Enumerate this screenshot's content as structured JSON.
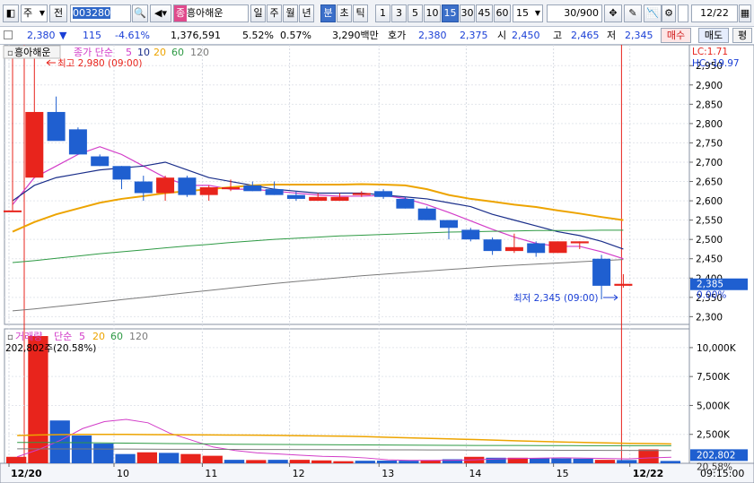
{
  "toolbar": {
    "market": "주",
    "screen_type": "전",
    "stock_code": "003280",
    "stock_badge": "종",
    "stock_name": "흥아해운",
    "periods": [
      "일",
      "주",
      "월",
      "년",
      "분",
      "초",
      "틱"
    ],
    "selected_period": "분",
    "intervals": [
      "1",
      "3",
      "5",
      "10",
      "15",
      "30",
      "45",
      "60"
    ],
    "selected_interval": "15",
    "interval_value": "15",
    "count": "30",
    "count_total": "/900",
    "date_value": "12/22"
  },
  "quote": {
    "price": "2,380",
    "change": "115",
    "change_pct": "-4.61%",
    "volume": "1,376,591",
    "vol_ratio": "5.52%",
    "turnover": "0.57%",
    "amount": "3,290백만",
    "ask_label": "호가",
    "ask": "2,380",
    "bid": "2,375",
    "open_label": "시",
    "open": "2,450",
    "high_label": "고",
    "high": "2,465",
    "low_label": "저",
    "low": "2,345",
    "buy_label": "매수",
    "sell_label": "매도",
    "last_label": "평"
  },
  "colors": {
    "up": "#e8241c",
    "down": "#1f5fd0",
    "ma5": "#d23cc8",
    "ma10": "#1a2e8a",
    "ma20": "#eda400",
    "ma60": "#2e9a44",
    "ma120": "#7a7a7a"
  },
  "price_panel": {
    "name": "흥아해운",
    "legend_prefix": "종가 단순",
    "ma_periods": [
      "5",
      "10",
      "20",
      "60",
      "120"
    ],
    "high_note": "최고 2,980 (09:00)",
    "low_note": "최저 2,345 (09:00)",
    "lc": "LC:1.71",
    "hc": "HC:-19.97",
    "current_price": "2,385",
    "current_pct": "0.00%"
  },
  "volume_panel": {
    "label": "거래량",
    "legend_prefix": "단순",
    "ma_periods": [
      "5",
      "20",
      "60",
      "120"
    ],
    "current_note": "202,802주(20.58%)",
    "current_value": "202,802",
    "current_pct": "20.58%"
  },
  "chart_data": [
    {
      "type": "candlestick",
      "title": "흥아해운",
      "x_labels": [
        "12/20",
        "10",
        "11",
        "12",
        "13",
        "14",
        "15",
        "12/22"
      ],
      "y_ticks": [
        2300,
        2350,
        2400,
        2450,
        2500,
        2550,
        2600,
        2650,
        2700,
        2750,
        2800,
        2850,
        2900,
        2950
      ],
      "ylim": [
        2280,
        2990
      ],
      "candles": [
        {
          "o": 2575,
          "h": 2975,
          "l": 2575,
          "c": 2575
        },
        {
          "o": 2660,
          "h": 2980,
          "l": 2660,
          "c": 2830
        },
        {
          "o": 2830,
          "h": 2870,
          "l": 2760,
          "c": 2755
        },
        {
          "o": 2785,
          "h": 2790,
          "l": 2720,
          "c": 2720
        },
        {
          "o": 2715,
          "h": 2720,
          "l": 2690,
          "c": 2690
        },
        {
          "o": 2690,
          "h": 2690,
          "l": 2630,
          "c": 2655
        },
        {
          "o": 2650,
          "h": 2665,
          "l": 2600,
          "c": 2620
        },
        {
          "o": 2620,
          "h": 2665,
          "l": 2600,
          "c": 2660
        },
        {
          "o": 2660,
          "h": 2665,
          "l": 2610,
          "c": 2615
        },
        {
          "o": 2615,
          "h": 2640,
          "l": 2600,
          "c": 2635
        },
        {
          "o": 2630,
          "h": 2655,
          "l": 2625,
          "c": 2635
        },
        {
          "o": 2640,
          "h": 2650,
          "l": 2625,
          "c": 2625
        },
        {
          "o": 2630,
          "h": 2650,
          "l": 2615,
          "c": 2615
        },
        {
          "o": 2615,
          "h": 2625,
          "l": 2600,
          "c": 2605
        },
        {
          "o": 2600,
          "h": 2620,
          "l": 2600,
          "c": 2610
        },
        {
          "o": 2600,
          "h": 2620,
          "l": 2600,
          "c": 2610
        },
        {
          "o": 2615,
          "h": 2625,
          "l": 2610,
          "c": 2620
        },
        {
          "o": 2625,
          "h": 2630,
          "l": 2605,
          "c": 2610
        },
        {
          "o": 2605,
          "h": 2610,
          "l": 2580,
          "c": 2580
        },
        {
          "o": 2580,
          "h": 2585,
          "l": 2550,
          "c": 2550
        },
        {
          "o": 2550,
          "h": 2550,
          "l": 2500,
          "c": 2530
        },
        {
          "o": 2525,
          "h": 2530,
          "l": 2495,
          "c": 2500
        },
        {
          "o": 2500,
          "h": 2505,
          "l": 2460,
          "c": 2470
        },
        {
          "o": 2470,
          "h": 2515,
          "l": 2465,
          "c": 2480
        },
        {
          "o": 2490,
          "h": 2495,
          "l": 2455,
          "c": 2465
        },
        {
          "o": 2465,
          "h": 2495,
          "l": 2465,
          "c": 2495
        },
        {
          "o": 2490,
          "h": 2495,
          "l": 2475,
          "c": 2495
        },
        {
          "o": 2450,
          "h": 2460,
          "l": 2345,
          "c": 2380
        },
        {
          "o": 2380,
          "h": 2410,
          "l": 2375,
          "c": 2385
        }
      ],
      "series": [
        {
          "name": "5",
          "values": [
            2590,
            2660,
            2690,
            2720,
            2740,
            2720,
            2690,
            2660,
            2640,
            2640,
            2630,
            2630,
            2625,
            2620,
            2615,
            2612,
            2612,
            2614,
            2606,
            2590,
            2570,
            2548,
            2526,
            2506,
            2490,
            2482,
            2482,
            2468,
            2450
          ]
        },
        {
          "name": "10",
          "values": [
            2600,
            2640,
            2660,
            2670,
            2680,
            2685,
            2690,
            2700,
            2680,
            2660,
            2650,
            2640,
            2630,
            2625,
            2620,
            2620,
            2620,
            2615,
            2610,
            2605,
            2595,
            2585,
            2565,
            2550,
            2535,
            2520,
            2510,
            2495,
            2475
          ]
        },
        {
          "name": "20",
          "values": [
            2520,
            2545,
            2565,
            2580,
            2595,
            2605,
            2612,
            2620,
            2625,
            2630,
            2635,
            2640,
            2642,
            2642,
            2642,
            2642,
            2643,
            2642,
            2640,
            2630,
            2615,
            2605,
            2598,
            2590,
            2584,
            2575,
            2567,
            2558,
            2550
          ]
        },
        {
          "name": "60",
          "values": [
            2440,
            2445,
            2451,
            2457,
            2463,
            2468,
            2473,
            2478,
            2483,
            2487,
            2492,
            2496,
            2500,
            2503,
            2506,
            2509,
            2511,
            2513,
            2515,
            2517,
            2519,
            2520,
            2521,
            2522,
            2523,
            2523,
            2523,
            2524,
            2524
          ]
        },
        {
          "name": "120",
          "values": [
            2315,
            2320,
            2326,
            2332,
            2338,
            2344,
            2350,
            2356,
            2362,
            2368,
            2374,
            2380,
            2386,
            2391,
            2396,
            2401,
            2406,
            2410,
            2414,
            2418,
            2422,
            2426,
            2430,
            2433,
            2436,
            2439,
            2442,
            2445,
            2448
          ]
        }
      ]
    },
    {
      "type": "bar",
      "title": "거래량",
      "y_ticks": [
        "2,500K",
        "5,000K",
        "7,500K",
        "10,000K"
      ],
      "ylim": [
        0,
        11000
      ],
      "unit": "K",
      "values": [
        560,
        11000,
        3700,
        2400,
        1700,
        800,
        950,
        900,
        800,
        650,
        300,
        280,
        300,
        300,
        250,
        180,
        220,
        230,
        220,
        260,
        350,
        560,
        480,
        480,
        450,
        420,
        400,
        300,
        280,
        1200,
        202.8
      ],
      "colors": [
        "up",
        "up",
        "down",
        "down",
        "down",
        "down",
        "up",
        "down",
        "up",
        "up",
        "down",
        "up",
        "down",
        "up",
        "up",
        "up",
        "down",
        "down",
        "down",
        "up",
        "down",
        "up",
        "down",
        "up",
        "down",
        "down",
        "down",
        "up",
        "down",
        "up",
        "down"
      ],
      "series": [
        {
          "name": "5",
          "values": [
            560,
            1200,
            2000,
            3000,
            3600,
            3800,
            3500,
            2600,
            2000,
            1400,
            1100,
            900,
            800,
            700,
            600,
            560,
            460,
            300,
            250,
            250,
            260,
            300,
            380,
            420,
            450,
            470,
            450,
            420,
            380,
            460,
            520
          ]
        },
        {
          "name": "20",
          "values": [
            2400,
            2450,
            2480,
            2500,
            2500,
            2500,
            2480,
            2470,
            2460,
            2450,
            2440,
            2430,
            2410,
            2380,
            2360,
            2340,
            2300,
            2250,
            2200,
            2150,
            2100,
            2050,
            1990,
            1940,
            1890,
            1840,
            1800,
            1760,
            1720,
            1700,
            1680
          ]
        },
        {
          "name": "60",
          "values": [
            1800,
            1800,
            1790,
            1780,
            1760,
            1740,
            1720,
            1700,
            1690,
            1670,
            1650,
            1640,
            1630,
            1620,
            1610,
            1600,
            1590,
            1580,
            1570,
            1560,
            1550,
            1540,
            1540,
            1540,
            1530,
            1530,
            1520,
            1520,
            1520,
            1520,
            1520
          ]
        },
        {
          "name": "120",
          "values": [
            1250,
            1245,
            1240,
            1235,
            1230,
            1225,
            1220,
            1215,
            1210,
            1205,
            1200,
            1195,
            1190,
            1185,
            1180,
            1175,
            1170,
            1165,
            1160,
            1155,
            1150,
            1145,
            1140,
            1135,
            1130,
            1125,
            1120,
            1115,
            1110,
            1105,
            1100
          ]
        }
      ],
      "x_labels": [
        "12/20",
        "10",
        "11",
        "12",
        "13",
        "14",
        "15",
        "12/22"
      ],
      "time_label": "09:15:00"
    }
  ]
}
